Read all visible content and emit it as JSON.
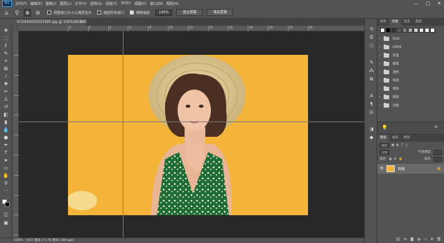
{
  "menu": {
    "logo": "Ps",
    "items": [
      "文件(F)",
      "编辑(E)",
      "图像(I)",
      "图层(L)",
      "文字(Y)",
      "选择(S)",
      "滤镜(T)",
      "3D(D)",
      "视图(V)",
      "窗口(W)",
      "帮助(H)"
    ],
    "controls": [
      "—",
      "□",
      "✕"
    ]
  },
  "options": {
    "resize_windows_label": "调整窗口大小以满屏显示",
    "zoom_all_label": "缩放所有窗口",
    "scrubby_zoom_label": "细微缩放",
    "zoom_value": "100%",
    "fit_screen_label": "适合屏幕",
    "fill_screen_label": "填充屏幕"
  },
  "document": {
    "tab_title": "VCG41N101021585",
    "tab_suffix": ".jpg @ 100%(RGB/8)",
    "tab_close": "×"
  },
  "ruler": {
    "top_numbers": [
      "0",
      "2",
      "4",
      "6",
      "8",
      "10",
      "12",
      "14",
      "16",
      "18",
      "20",
      "22",
      "24"
    ]
  },
  "status": {
    "zoom": "100%",
    "dimensions": "8.67 厘米 x 5.76 厘米 (300 ppi)"
  },
  "swatches_panel": {
    "tabs": [
      "颜色",
      "色板",
      "渐变",
      "图案"
    ],
    "active_tab": 1,
    "swatch_colors": [
      "#ffffff",
      "#000000",
      "#303030",
      "#5a5a5a",
      "#808080",
      "#a6a6a6",
      "#d0d0d0",
      "#e6e6e6",
      "#f3f3f3",
      "#ffffff"
    ],
    "folders": [
      "RGB",
      "CMYK",
      "灰度",
      "蜡笔",
      "浅色",
      "纯净",
      "暗色",
      "较暗",
      "淡色"
    ]
  },
  "layers_panel": {
    "tabs": [
      "图层",
      "通道",
      "路径"
    ],
    "filter_label": "类型",
    "blend_mode": "正常",
    "opacity_label": "不透明度:",
    "lock_label": "锁定:",
    "fill_label": "填充:",
    "layer_name": "背景"
  },
  "colors": {
    "ui_bg": "#535353",
    "canvas_bg": "#282828",
    "photo_bg": "#f4b43a",
    "accent": "#31a8ff"
  }
}
